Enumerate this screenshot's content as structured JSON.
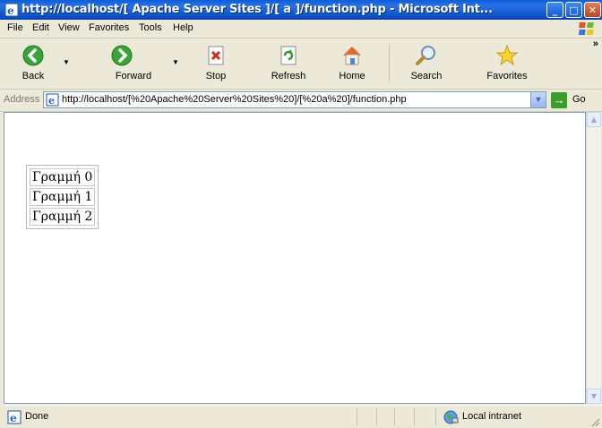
{
  "window": {
    "title": "http://localhost/[ Apache Server Sites ]/[ a ]/function.php - Microsoft Int...",
    "controls": {
      "minimize": "_",
      "maximize": "□",
      "close": "✕"
    }
  },
  "menu": [
    "File",
    "Edit",
    "View",
    "Favorites",
    "Tools",
    "Help"
  ],
  "toolbar": {
    "back": "Back",
    "forward": "Forward",
    "stop": "Stop",
    "refresh": "Refresh",
    "home": "Home",
    "search": "Search",
    "favorites": "Favorites",
    "more": "»"
  },
  "address": {
    "label": "Address",
    "url": "http://localhost/[%20Apache%20Server%20Sites%20]/[%20a%20]/function.php",
    "go": "Go"
  },
  "content": {
    "rows": [
      "Γραμμή 0",
      "Γραμμή 1",
      "Γραμμή 2"
    ]
  },
  "status": {
    "text": "Done",
    "zone": "Local intranet"
  },
  "colors": {
    "titlebar": "#0a5fd8",
    "chrome": "#ece9d8",
    "go": "#3a9e2a"
  }
}
